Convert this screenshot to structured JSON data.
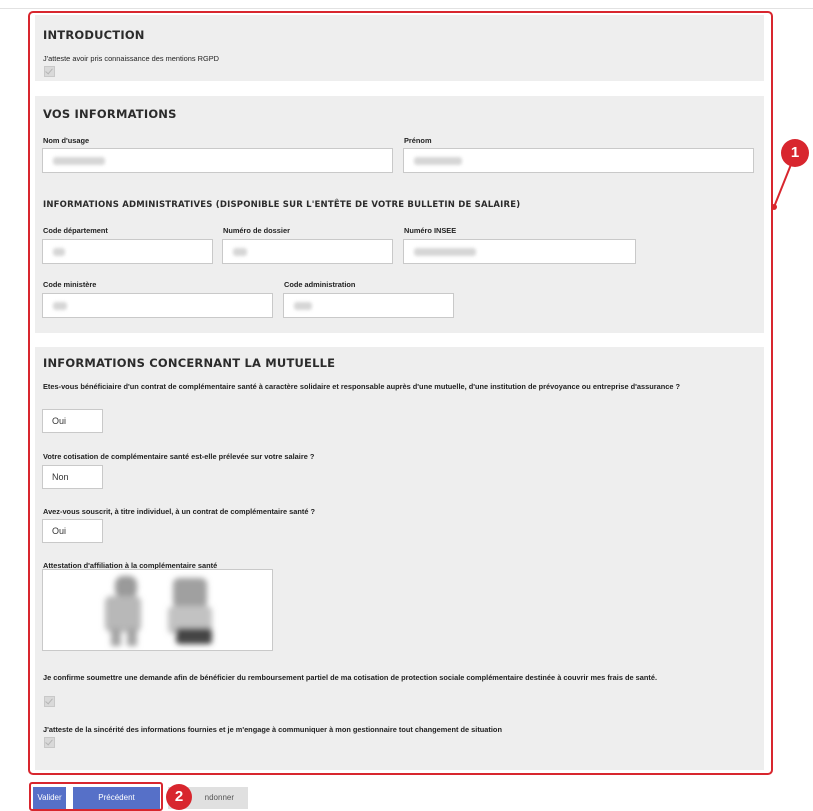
{
  "introduction": {
    "title": "INTRODUCTION",
    "rgpd_label": "J'atteste avoir pris connaissance des mentions RGPD",
    "rgpd_checked": true
  },
  "vos_informations": {
    "title": "VOS INFORMATIONS",
    "nom_label": "Nom d'usage",
    "prenom_label": "Prénom",
    "admin_title": "INFORMATIONS ADMINISTRATIVES (DISPONIBLE SUR L'ENTÊTE DE VOTRE BULLETIN DE SALAIRE)",
    "code_departement_label": "Code département",
    "numero_dossier_label": "Numéro de dossier",
    "numero_insee_label": "Numéro INSEE",
    "code_ministere_label": "Code ministère",
    "code_administration_label": "Code administration"
  },
  "mutuelle": {
    "title": "INFORMATIONS CONCERNANT LA MUTUELLE",
    "q1_label": "Etes-vous bénéficiaire d'un contrat de complémentaire santé à caractère solidaire et responsable auprès d'une mutuelle, d'une institution de prévoyance ou entreprise d'assurance ?",
    "q1_value": "Oui",
    "q2_label": "Votre cotisation de complémentaire santé est-elle prélevée sur votre salaire ?",
    "q2_value": "Non",
    "q3_label": "Avez-vous souscrit, à titre individuel, à un contrat de complémentaire santé ?",
    "q3_value": "Oui",
    "attestation_label": "Attestation d'affiliation à la complémentaire santé",
    "confirm_label": "Je confirme soumettre une demande afin de bénéficier du remboursement partiel de ma cotisation de protection sociale complémentaire destinée à couvrir mes frais de santé.",
    "sincerite_label": "J'atteste de la sincérité des informations fournies et je m'engage à communiquer à mon gestionnaire tout changement de situation"
  },
  "badges": {
    "one": "1",
    "two": "2"
  },
  "buttons": {
    "valider": "Valider",
    "precedent": "Précédent",
    "abandonner_visible": "ndonner"
  },
  "colors": {
    "accent_red": "#d8262e",
    "button_blue": "#5670c8",
    "section_grey": "#eeeeee"
  }
}
